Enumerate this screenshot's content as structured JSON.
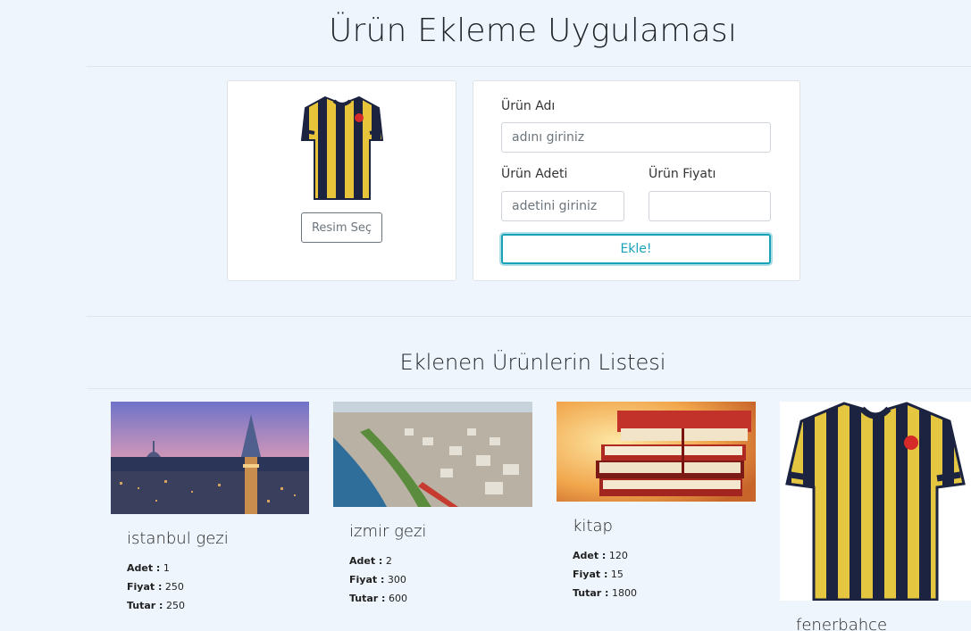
{
  "header": {
    "title": "Ürün Ekleme Uygulaması"
  },
  "image_picker": {
    "preview_icon": "football-jersey-icon",
    "select_label": "Resim Seç"
  },
  "form": {
    "name_label": "Ürün Adı",
    "name_placeholder": "adını giriniz",
    "qty_label": "Ürün Adeti",
    "qty_placeholder": "adetini giriniz",
    "price_label": "Ürün Fiyatı",
    "price_placeholder": "",
    "submit_label": "Ekle!",
    "accent": "#17a2b8"
  },
  "list": {
    "title": "Eklenen Ürünlerin Listesi",
    "adet_label": "Adet :",
    "fiyat_label": "Fiyat :",
    "tutar_label": "Tutar :",
    "items": [
      {
        "name": "istanbul gezi",
        "adet": "1",
        "fiyat": "250",
        "tutar": "250",
        "image": "istanbul-galata-tower-photo"
      },
      {
        "name": "izmir gezi",
        "adet": "2",
        "fiyat": "300",
        "tutar": "600",
        "image": "izmir-coastline-photo"
      },
      {
        "name": "kitap",
        "adet": "120",
        "fiyat": "15",
        "tutar": "1800",
        "image": "stack-of-books-photo"
      },
      {
        "name": "fenerbahce",
        "image": "football-jersey-photo"
      }
    ]
  }
}
